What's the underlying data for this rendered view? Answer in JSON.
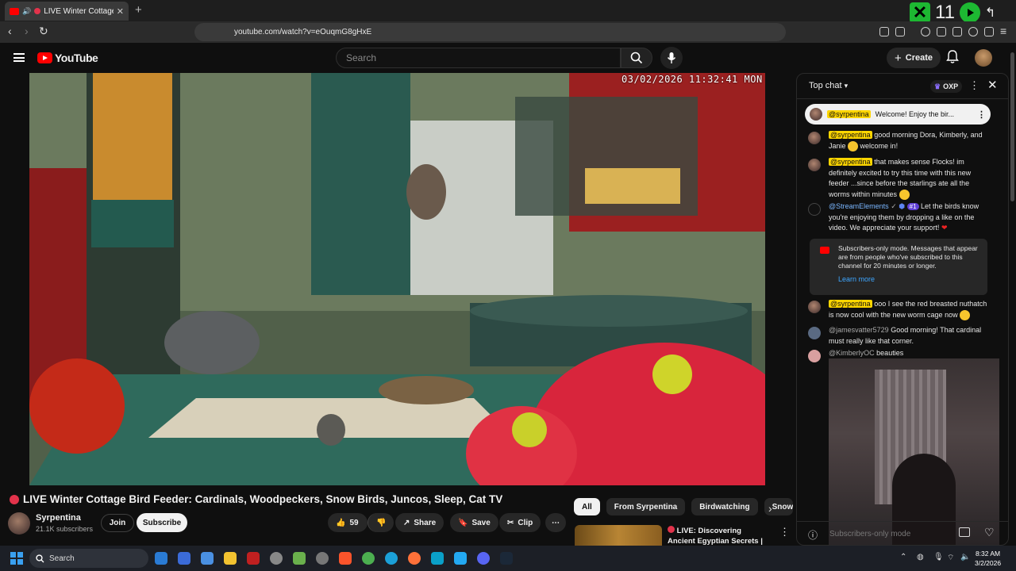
{
  "browser": {
    "tab_title": "LIVE Winter Cottage Bird F",
    "url": "youtube.com/watch?v=eOuqmG8gHxE",
    "overlay_numbers": "11"
  },
  "youtube": {
    "logo_text": "YouTube",
    "search_placeholder": "Search",
    "create_label": "Create"
  },
  "video": {
    "timestamp": "03/02/2026 11:32:41 MON",
    "title": "LIVE Winter Cottage Bird Feeder: Cardinals, Woodpeckers, Snow Birds, Juncos, Sleep, Cat TV",
    "channel": "Syrpentina",
    "subscribers": "21.1K subscribers",
    "join_label": "Join",
    "subscribe_label": "Subscribe",
    "likes": "59",
    "share_label": "Share",
    "save_label": "Save",
    "clip_label": "Clip"
  },
  "chips": [
    "All",
    "From Syrpentina",
    "Birdwatching",
    "Snow"
  ],
  "recommendation": {
    "title": "LIVE: Discovering Ancient Egyptian Secrets | Lost ..."
  },
  "chat": {
    "header": "Top chat",
    "points_label": "OXP",
    "pinned_user": "@syrpentina",
    "pinned_text": "Welcome! Enjoy the bir...",
    "messages": [
      {
        "user": "@syrpentina",
        "text": "good morning Dora, Kimberly, and Janie",
        "text2": "welcome in!"
      },
      {
        "user": "@syrpentina",
        "text": "that makes sense Flocks! im definitely excited to try this time with this new feeder ...since before the starlings ate all the worms within minutes"
      },
      {
        "user": "@StreamElements",
        "rank": "#1",
        "text": "Let the birds know you're enjoying them by dropping a like on the video. We appreciate your support!"
      },
      {
        "user": "@syrpentina",
        "text": "ooo I see the red breasted nuthatch is now cool with the new worm cage now"
      },
      {
        "user": "@jamesvatter5729",
        "text": "Good morning! That cardinal must really like that corner."
      },
      {
        "user": "@KimberlyOC",
        "text": "beauties"
      }
    ],
    "subscribers_notice": "Subscribers-only mode. Messages that appear are from people who've subscribed to this channel for 20 minutes or longer.",
    "learn_more": "Learn more",
    "input_placeholder": "Subscribers-only mode"
  },
  "taskbar": {
    "search_label": "Search",
    "time": "8:32 AM",
    "date": "3/2/2026"
  }
}
